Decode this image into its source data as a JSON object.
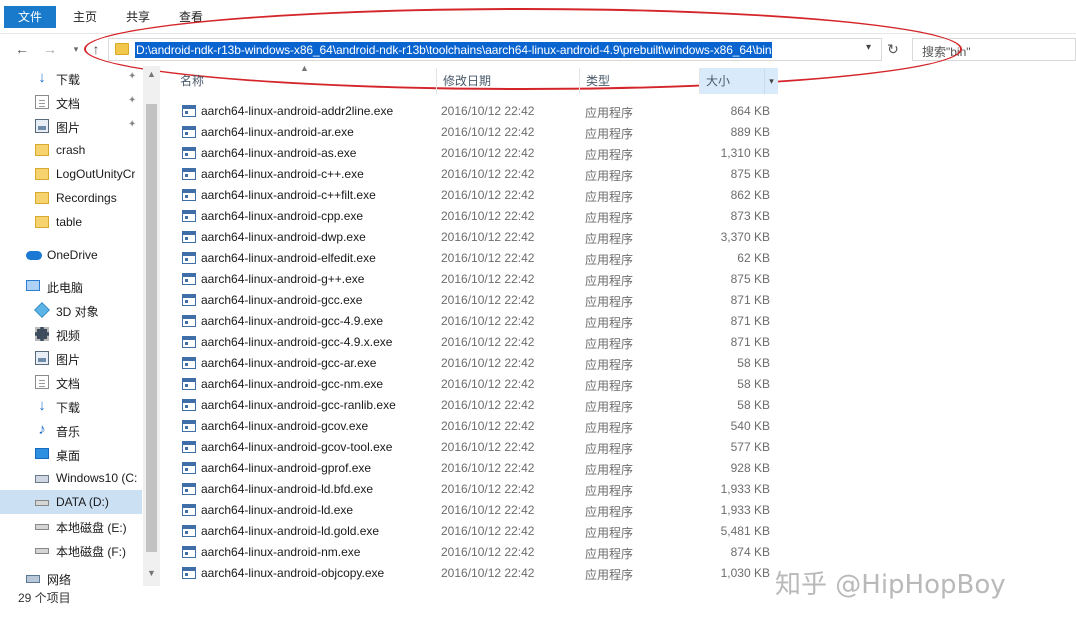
{
  "ribbon": {
    "tabs": [
      "文件",
      "主页",
      "共享",
      "查看"
    ]
  },
  "address": {
    "path": "D:\\android-ndk-r13b-windows-x86_64\\android-ndk-r13b\\toolchains\\aarch64-linux-android-4.9\\prebuilt\\windows-x86_64\\bin",
    "search_placeholder": "搜索\"bin\""
  },
  "sidebar": {
    "items": [
      {
        "label": "下载",
        "icon": "download-arrow-icon",
        "pinned": true
      },
      {
        "label": "文档",
        "icon": "document-icon",
        "pinned": true
      },
      {
        "label": "图片",
        "icon": "picture-icon",
        "pinned": true
      },
      {
        "label": "crash",
        "icon": "folder-icon"
      },
      {
        "label": "LogOutUnityCr",
        "icon": "folder-icon"
      },
      {
        "label": "Recordings",
        "icon": "folder-icon"
      },
      {
        "label": "table",
        "icon": "folder-icon"
      },
      {
        "label": "OneDrive",
        "icon": "onedrive-cloud-icon"
      },
      {
        "label": "此电脑",
        "icon": "this-pc-icon"
      },
      {
        "label": "3D 对象",
        "icon": "3d-objects-icon"
      },
      {
        "label": "视频",
        "icon": "video-icon"
      },
      {
        "label": "图片",
        "icon": "picture-icon"
      },
      {
        "label": "文档",
        "icon": "document-icon"
      },
      {
        "label": "下载",
        "icon": "download-arrow-icon"
      },
      {
        "label": "音乐",
        "icon": "music-note-icon"
      },
      {
        "label": "桌面",
        "icon": "desktop-icon"
      },
      {
        "label": "Windows10 (C:",
        "icon": "windows-drive-icon"
      },
      {
        "label": "DATA (D:)",
        "icon": "drive-icon",
        "selected": true
      },
      {
        "label": "本地磁盘 (E:)",
        "icon": "drive-icon"
      },
      {
        "label": "本地磁盘 (F:)",
        "icon": "drive-icon"
      },
      {
        "label": "网络",
        "icon": "network-icon"
      }
    ]
  },
  "columns": {
    "name": "名称",
    "date": "修改日期",
    "type": "类型",
    "size": "大小"
  },
  "files": [
    {
      "name": "aarch64-linux-android-addr2line.exe",
      "date": "2016/10/12 22:42",
      "type": "应用程序",
      "size": "864 KB"
    },
    {
      "name": "aarch64-linux-android-ar.exe",
      "date": "2016/10/12 22:42",
      "type": "应用程序",
      "size": "889 KB"
    },
    {
      "name": "aarch64-linux-android-as.exe",
      "date": "2016/10/12 22:42",
      "type": "应用程序",
      "size": "1,310 KB"
    },
    {
      "name": "aarch64-linux-android-c++.exe",
      "date": "2016/10/12 22:42",
      "type": "应用程序",
      "size": "875 KB"
    },
    {
      "name": "aarch64-linux-android-c++filt.exe",
      "date": "2016/10/12 22:42",
      "type": "应用程序",
      "size": "862 KB"
    },
    {
      "name": "aarch64-linux-android-cpp.exe",
      "date": "2016/10/12 22:42",
      "type": "应用程序",
      "size": "873 KB"
    },
    {
      "name": "aarch64-linux-android-dwp.exe",
      "date": "2016/10/12 22:42",
      "type": "应用程序",
      "size": "3,370 KB"
    },
    {
      "name": "aarch64-linux-android-elfedit.exe",
      "date": "2016/10/12 22:42",
      "type": "应用程序",
      "size": "62 KB"
    },
    {
      "name": "aarch64-linux-android-g++.exe",
      "date": "2016/10/12 22:42",
      "type": "应用程序",
      "size": "875 KB"
    },
    {
      "name": "aarch64-linux-android-gcc.exe",
      "date": "2016/10/12 22:42",
      "type": "应用程序",
      "size": "871 KB"
    },
    {
      "name": "aarch64-linux-android-gcc-4.9.exe",
      "date": "2016/10/12 22:42",
      "type": "应用程序",
      "size": "871 KB"
    },
    {
      "name": "aarch64-linux-android-gcc-4.9.x.exe",
      "date": "2016/10/12 22:42",
      "type": "应用程序",
      "size": "871 KB"
    },
    {
      "name": "aarch64-linux-android-gcc-ar.exe",
      "date": "2016/10/12 22:42",
      "type": "应用程序",
      "size": "58 KB"
    },
    {
      "name": "aarch64-linux-android-gcc-nm.exe",
      "date": "2016/10/12 22:42",
      "type": "应用程序",
      "size": "58 KB"
    },
    {
      "name": "aarch64-linux-android-gcc-ranlib.exe",
      "date": "2016/10/12 22:42",
      "type": "应用程序",
      "size": "58 KB"
    },
    {
      "name": "aarch64-linux-android-gcov.exe",
      "date": "2016/10/12 22:42",
      "type": "应用程序",
      "size": "540 KB"
    },
    {
      "name": "aarch64-linux-android-gcov-tool.exe",
      "date": "2016/10/12 22:42",
      "type": "应用程序",
      "size": "577 KB"
    },
    {
      "name": "aarch64-linux-android-gprof.exe",
      "date": "2016/10/12 22:42",
      "type": "应用程序",
      "size": "928 KB"
    },
    {
      "name": "aarch64-linux-android-ld.bfd.exe",
      "date": "2016/10/12 22:42",
      "type": "应用程序",
      "size": "1,933 KB"
    },
    {
      "name": "aarch64-linux-android-ld.exe",
      "date": "2016/10/12 22:42",
      "type": "应用程序",
      "size": "1,933 KB"
    },
    {
      "name": "aarch64-linux-android-ld.gold.exe",
      "date": "2016/10/12 22:42",
      "type": "应用程序",
      "size": "5,481 KB"
    },
    {
      "name": "aarch64-linux-android-nm.exe",
      "date": "2016/10/12 22:42",
      "type": "应用程序",
      "size": "874 KB"
    },
    {
      "name": "aarch64-linux-android-objcopy.exe",
      "date": "2016/10/12 22:42",
      "type": "应用程序",
      "size": "1,030 KB"
    }
  ],
  "status": {
    "item_count": "29 个项目"
  },
  "watermark": "知乎 @HipHopBoy",
  "colors": {
    "accent": "#1979ca",
    "selection": "#0a64d0",
    "annotation": "#d4262a"
  }
}
